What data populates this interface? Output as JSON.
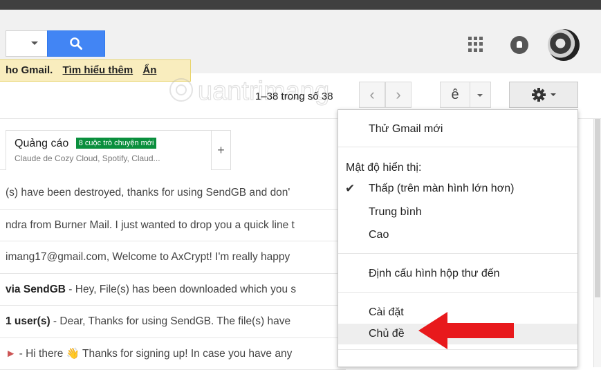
{
  "header": {
    "brand_color": "#4285f4",
    "icons": [
      "search-icon",
      "apps-grid-icon",
      "notifications-icon",
      "account-avatar"
    ]
  },
  "promo": {
    "text": "ho Gmail.",
    "learn_more": "Tìm hiểu thêm",
    "hide": "Ẩn"
  },
  "toolbar": {
    "page_count": "1–38 trong số 38",
    "prev": "‹",
    "next": "›",
    "input_tool": "ê"
  },
  "tabs": {
    "promotions": {
      "title": "Quảng cáo",
      "badge": "8 cuộc trò chuyện mới",
      "badge_color": "#0a8f3d",
      "senders": "Claude de Cozy Cloud, Spotify, Claud..."
    },
    "add": "+"
  },
  "emails": [
    {
      "sender": "",
      "snippet": "(s) have been destroyed, thanks for using SendGB and don'"
    },
    {
      "sender": "",
      "snippet": "ndra from Burner Mail. I just wanted to drop you a quick line t"
    },
    {
      "sender": "",
      "snippet": "imang17@gmail.com, Welcome to AxCrypt! I'm really happy"
    },
    {
      "sender": "via SendGB",
      "snippet": " - Hey, File(s) has been downloaded which you s"
    },
    {
      "sender": "1 user(s)",
      "snippet": " - Dear, Thanks for using SendGB. The file(s) have"
    },
    {
      "sender": "",
      "snippet": " - Hi there 👋 Thanks for signing up! In case you have any"
    }
  ],
  "settings_menu": {
    "try_new": "Thử Gmail mới",
    "density_label": "Mật độ hiển thị:",
    "density_compact": "Thấp (trên màn hình lớn hơn)",
    "density_cozy": "Trung bình",
    "density_comfortable": "Cao",
    "configure_inbox": "Định cấu hình hộp thư đến",
    "settings": "Cài đặt",
    "themes": "Chủ đề",
    "highlight_arrow_color": "#e8191c"
  }
}
